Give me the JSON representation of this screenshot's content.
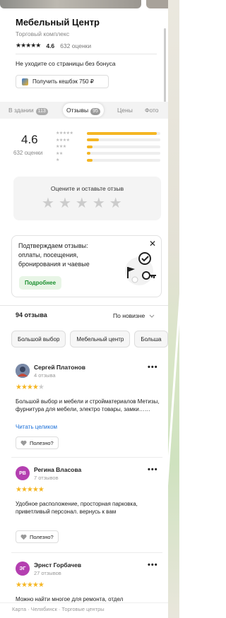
{
  "place": {
    "title": "Мебельный Центр",
    "subtitle": "Торговый комплекс",
    "rating_stars": "★★★★★",
    "rating": "4.6",
    "ratings_count": "632 оценки",
    "promo_text": "Не уходите со страницы без бонуса",
    "cashback_label": "Получить кешбэк 750 ₽"
  },
  "tabs": [
    {
      "label": "В здании",
      "count": "113"
    },
    {
      "label": "Отзывы",
      "count": "95"
    },
    {
      "label": "Цены",
      "count": ""
    },
    {
      "label": "Фото",
      "count": ""
    }
  ],
  "summary": {
    "rating": "4.6",
    "count_label": "632 оценки",
    "distribution": [
      {
        "stars": "★★★★★",
        "share": 0.95
      },
      {
        "stars": "★★★★",
        "share": 0.16
      },
      {
        "stars": "★★★",
        "share": 0.08
      },
      {
        "stars": "★★",
        "share": 0.05
      },
      {
        "stars": "★",
        "share": 0.08
      }
    ]
  },
  "rate_box": {
    "title": "Оцените и оставьте отзыв",
    "stars": [
      "★",
      "★",
      "★",
      "★",
      "★"
    ]
  },
  "confirm": {
    "text": "Подтверждаем отзывы: оплаты, посещения, бронирования и чаевые",
    "button": "Подробнее",
    "close": "✕"
  },
  "reviews_header": {
    "count": "94 отзыва",
    "sort": "По новизне"
  },
  "chips": [
    "Большой выбор",
    "Мебельный центр",
    "Больша"
  ],
  "reviews": [
    {
      "name": "Сергей Платонов",
      "sub": "4 отзыва",
      "initials": "",
      "avatar_color": "#5b6b8a",
      "stars_on": "★★★★",
      "stars_off": "★",
      "text": "Большой выбор и мебели и стройматериалов Метизы, фурнитура для мебели, электро товары, замки……",
      "link": "Читать целиком",
      "useful": "Полезно?"
    },
    {
      "name": "Регина Власова",
      "sub": "7 отзывов",
      "initials": "РВ",
      "avatar_color": "#b43fb0",
      "stars_on": "★★★★★",
      "stars_off": "",
      "text": "Удобное расположение, просторная парковка, приветливый персонал. вернусь к вам",
      "link": "",
      "useful": "Полезно?"
    },
    {
      "name": "Эрнст Горбачев",
      "sub": "27 отзывов",
      "initials": "ЭГ",
      "avatar_color": "#b43fb0",
      "stars_on": "★★★★★",
      "stars_off": "",
      "text": "Можно найти многое для ремонта, отдел",
      "link": "",
      "useful": ""
    }
  ],
  "more_icon": "•••",
  "footer": "Карта · Челябинск · Торговые центры",
  "colors": {
    "accent_star": "#f5b623",
    "link": "#1a6fd8",
    "confirm_green": "#1a8f2e"
  }
}
